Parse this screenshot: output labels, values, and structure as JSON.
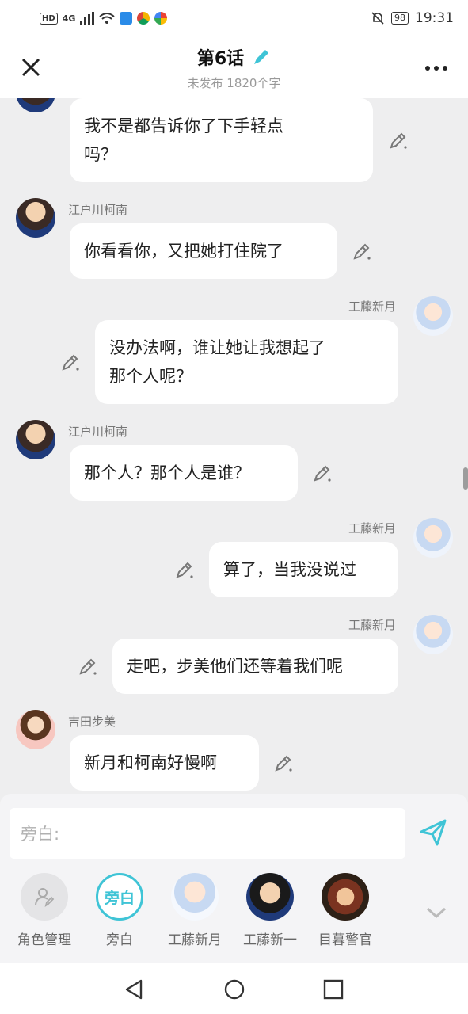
{
  "status_bar": {
    "left_tags": [
      "HD",
      "4G"
    ],
    "battery": "98",
    "time": "19:31"
  },
  "header": {
    "title": "第6话",
    "subtitle": "未发布 1820个字"
  },
  "messages": [
    {
      "speaker": "",
      "side": "left",
      "text_lines": [
        "我不是都告诉你了下手轻点",
        "吗？"
      ]
    },
    {
      "speaker": "江户川柯南",
      "side": "left",
      "text_lines": [
        "你看看你，又把她打住院了"
      ]
    },
    {
      "speaker": "工藤新月",
      "side": "right",
      "text_lines": [
        "没办法啊，谁让她让我想起了",
        "那个人呢？"
      ]
    },
    {
      "speaker": "江户川柯南",
      "side": "left",
      "text_lines": [
        "那个人？那个人是谁？"
      ]
    },
    {
      "speaker": "工藤新月",
      "side": "right",
      "text_lines": [
        "算了，当我没说过"
      ]
    },
    {
      "speaker": "工藤新月",
      "side": "right",
      "text_lines": [
        "走吧，步美他们还等着我们呢"
      ]
    },
    {
      "speaker": "吉田步美",
      "side": "left",
      "text_lines": [
        "新月和柯南好慢啊"
      ]
    }
  ],
  "input": {
    "placeholder": "旁白:"
  },
  "roles": [
    {
      "label": "角色管理",
      "icon": "role-manage-icon"
    },
    {
      "label": "旁白",
      "badge": "旁白"
    },
    {
      "label": "工藤新月"
    },
    {
      "label": "工藤新一"
    },
    {
      "label": "目暮警官"
    }
  ],
  "colors": {
    "accent": "#3fc4d6",
    "background": "#eeeeef",
    "bubble": "#ffffff"
  }
}
